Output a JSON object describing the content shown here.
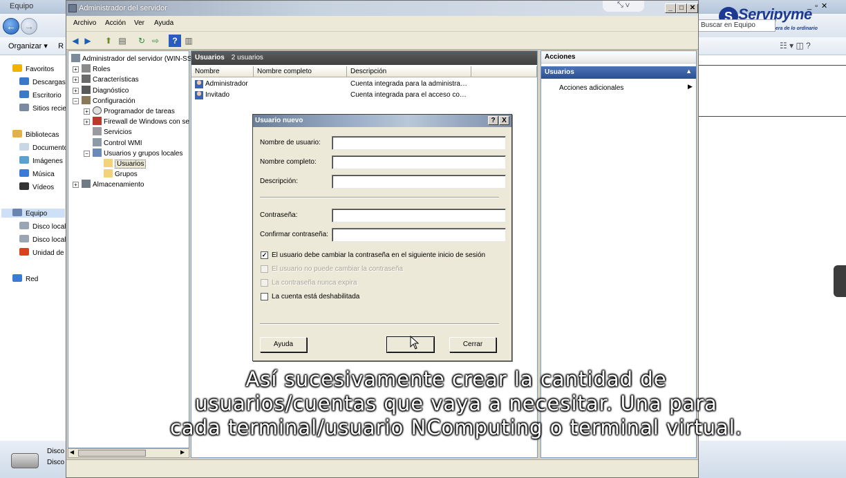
{
  "explorer": {
    "title": "Equipo",
    "organize": "Organizar",
    "organize_tail": "R",
    "search": "Buscar en Equipo",
    "sidebar": [
      {
        "label": "Favoritos",
        "icon": "star-icon",
        "color": "#f0b400",
        "group": true
      },
      {
        "label": "Descargas",
        "icon": "folder-icon",
        "color": "#3b78c9"
      },
      {
        "label": "Escritorio",
        "icon": "desktop-icon",
        "color": "#3b78c9"
      },
      {
        "label": "Sitios recie",
        "icon": "folder-icon",
        "color": "#7a8aa0"
      },
      {
        "label": "Bibliotecas",
        "icon": "library-icon",
        "color": "#e3b04b",
        "group": true
      },
      {
        "label": "Documento",
        "icon": "document-icon",
        "color": "#c9d6e6"
      },
      {
        "label": "Imágenes",
        "icon": "pictures-icon",
        "color": "#5aa0d0"
      },
      {
        "label": "Música",
        "icon": "music-icon",
        "color": "#3a7bd5"
      },
      {
        "label": "Vídeos",
        "icon": "video-icon",
        "color": "#333333"
      },
      {
        "label": "Equipo",
        "icon": "computer-icon",
        "color": "#6a86b0",
        "group": true,
        "selected": true
      },
      {
        "label": "Disco local",
        "icon": "drive-icon",
        "color": "#9aa6b4"
      },
      {
        "label": "Disco local",
        "icon": "drive-icon",
        "color": "#9aa6b4"
      },
      {
        "label": "Unidad de I",
        "icon": "office-icon",
        "color": "#d9421c"
      },
      {
        "label": "Red",
        "icon": "network-icon",
        "color": "#3a7bd5",
        "group": true
      }
    ],
    "status_lines": [
      "Disco",
      "Disco"
    ]
  },
  "logo": {
    "name": "Servipyme",
    "tagline": "Soluciones fuera de lo ordinario",
    "badge": "S"
  },
  "server_manager": {
    "title": "Administrador del servidor",
    "menus": [
      "Archivo",
      "Acción",
      "Ver",
      "Ayuda"
    ],
    "tree": [
      {
        "label": "Administrador del servidor (WIN-SS",
        "level": 0,
        "exp": "",
        "icon": "server-icon"
      },
      {
        "label": "Roles",
        "level": 1,
        "exp": "+",
        "icon": "roles-icon"
      },
      {
        "label": "Características",
        "level": 1,
        "exp": "+",
        "icon": "features-icon"
      },
      {
        "label": "Diagnóstico",
        "level": 1,
        "exp": "+",
        "icon": "diagnostics-icon"
      },
      {
        "label": "Configuración",
        "level": 1,
        "exp": "−",
        "icon": "configuration-icon"
      },
      {
        "label": "Programador de tareas",
        "level": 2,
        "exp": "+",
        "icon": "clock-icon"
      },
      {
        "label": "Firewall de Windows con se",
        "level": 2,
        "exp": "+",
        "icon": "firewall-icon"
      },
      {
        "label": "Servicios",
        "level": 2,
        "exp": "",
        "icon": "gear-icon"
      },
      {
        "label": "Control WMI",
        "level": 2,
        "exp": "",
        "icon": "wmi-icon"
      },
      {
        "label": "Usuarios y grupos locales",
        "level": 2,
        "exp": "−",
        "icon": "users-icon"
      },
      {
        "label": "Usuarios",
        "level": 3,
        "exp": "",
        "icon": "folder-icon",
        "selected": true
      },
      {
        "label": "Grupos",
        "level": 3,
        "exp": "",
        "icon": "folder-icon"
      },
      {
        "label": "Almacenamiento",
        "level": 1,
        "exp": "+",
        "icon": "storage-icon"
      }
    ],
    "center": {
      "title": "Usuarios",
      "count": "2 usuarios",
      "columns": [
        "Nombre",
        "Nombre completo",
        "Descripción"
      ],
      "rows": [
        {
          "name": "Administrador",
          "full": "",
          "desc": "Cuenta integrada para la administra…"
        },
        {
          "name": "Invitado",
          "full": "",
          "desc": "Cuenta integrada para el acceso co…"
        }
      ]
    },
    "actions": {
      "title": "Acciones",
      "section": "Usuarios",
      "item": "Acciones adicionales"
    }
  },
  "dialog": {
    "title": "Usuario nuevo",
    "help_btn": "?",
    "close_btn": "X",
    "fields": [
      {
        "label": "Nombre de usuario:",
        "value": ""
      },
      {
        "label": "Nombre completo:",
        "value": ""
      },
      {
        "label": "Descripción:",
        "value": ""
      }
    ],
    "password_fields": [
      {
        "label": "Contraseña:",
        "value": ""
      },
      {
        "label": "Confirmar contraseña:",
        "value": ""
      }
    ],
    "checkboxes": [
      {
        "label": "El usuario debe cambiar la contraseña en el siguiente inicio de sesión",
        "checked": true,
        "disabled": false
      },
      {
        "label": "El usuario no puede cambiar la contraseña",
        "checked": false,
        "disabled": true
      },
      {
        "label": "La contraseña nunca expira",
        "checked": false,
        "disabled": true
      },
      {
        "label": "La cuenta está deshabilitada",
        "checked": false,
        "disabled": false
      }
    ],
    "buttons": {
      "help": "Ayuda",
      "create": "Crear",
      "close": "Cerrar"
    }
  },
  "subtitle": [
    "Así sucesivamente crear la cantidad de",
    "usuarios/cuentas que vaya a necesitar. Una para",
    "cada terminal/usuario NComputing o terminal virtual."
  ]
}
